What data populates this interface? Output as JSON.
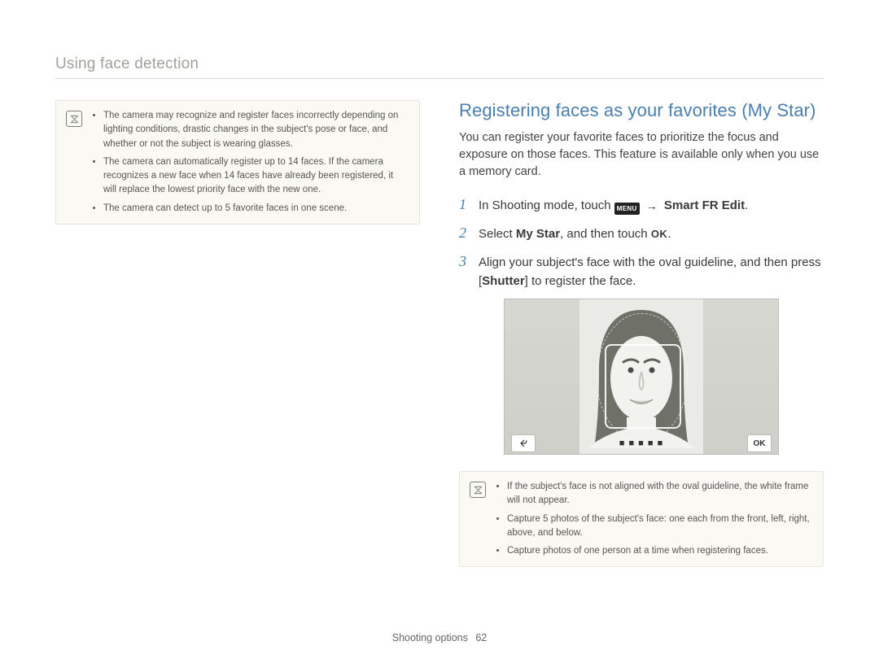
{
  "header": {
    "section": "Using face detection"
  },
  "left_note": {
    "items": [
      "The camera may recognize and register faces incorrectly depending on lighting conditions, drastic changes in the subject's pose or face, and whether or not the subject is wearing glasses.",
      "The camera can automatically register up to 14 faces. If the camera recognizes a new face when 14 faces have already been registered, it will replace the lowest priority face with the new one.",
      "The camera can detect up to 5 favorite faces in one scene."
    ]
  },
  "right": {
    "title": "Registering faces as your favorites (My Star)",
    "intro": "You can register your favorite faces to prioritize the focus and exposure on those faces. This feature is available only when you use a memory card.",
    "step1": {
      "pre": "In Shooting mode, touch ",
      "menu_chip": "MENU",
      "bold": "Smart FR Edit",
      "post": "."
    },
    "step2": {
      "pre": "Select ",
      "bold": "My Star",
      "mid": ", and then touch ",
      "ok_chip": "OK",
      "post": "."
    },
    "step3": {
      "pre": "Align your subject's face with the oval guideline, and then press [",
      "bold": "Shutter",
      "post": "] to register the face."
    },
    "device": {
      "ok_label": "OK"
    },
    "bottom_note": {
      "items": [
        "If the subject's face is not aligned with the oval guideline, the white frame will not appear.",
        "Capture 5 photos of the subject's face: one each from the front, left, right, above, and below.",
        "Capture photos of one person at a time when registering faces."
      ]
    }
  },
  "footer": {
    "label": "Shooting options",
    "page": "62"
  }
}
